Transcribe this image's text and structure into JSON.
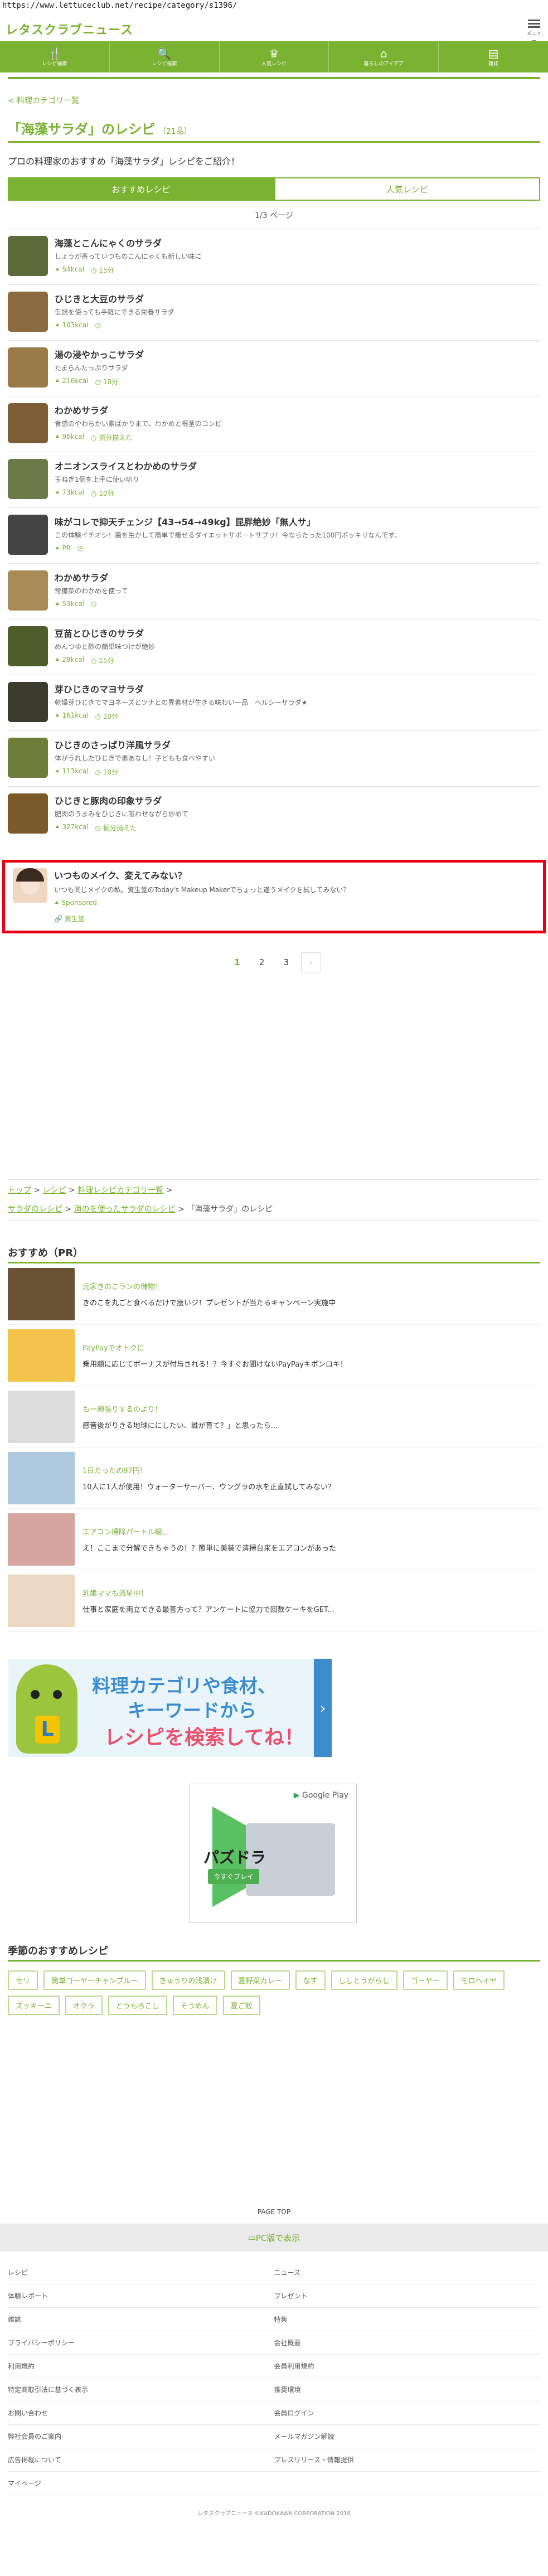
{
  "browser": {
    "url": "https://www.lettuceclub.net/recipe/category/s1396/"
  },
  "site": {
    "logo_main": "レタスクラブ",
    "logo_sub": "ニュース",
    "menu_label": "メニュー"
  },
  "nav": [
    {
      "label": "レシピ検索",
      "icon": "fork-knife-icon",
      "glyph": "🍴"
    },
    {
      "label": "レシピ検索",
      "icon": "search-icon",
      "glyph": "🔍"
    },
    {
      "label": "人気レシピ",
      "icon": "crown-icon",
      "glyph": "♛"
    },
    {
      "label": "暮らしのアイデア",
      "icon": "house-icon",
      "glyph": "⌂"
    },
    {
      "label": "雑誌",
      "icon": "book-icon",
      "glyph": "▤"
    }
  ],
  "back_link": "< 料理カテゴリ一覧",
  "page": {
    "title": "「海藻サラダ」のレシピ",
    "count": "（21品）",
    "intro": "プロの料理家のおすすめ「海藻サラダ」レシピをご紹介！"
  },
  "tabs": {
    "recommended": "おすすめレシピ",
    "popular": "人気レシピ"
  },
  "pager_top": "1/3 ページ",
  "recipes": [
    {
      "title": "海藻とこんにゃくのサラダ",
      "desc": "しょうが香っていつものこんにゃくも新しい味に",
      "kcal": "54kcal",
      "time": "15分",
      "color": "#5d6b3a"
    },
    {
      "title": "ひじきと大豆のサラダ",
      "desc": "缶詰を使っても手軽にできる栄養サラダ",
      "kcal": "103kcal",
      "time": "",
      "color": "#8a6a3e"
    },
    {
      "title": "湯の浸やかっこサラダ",
      "desc": "たまらんたっぷりサラダ",
      "kcal": "216kcal",
      "time": "10分",
      "color": "#9b7a4a"
    },
    {
      "title": "わかめサラダ",
      "desc": "食感のやわらかい素ばかりまで。わかめと根茎のコンビ",
      "kcal": "96kcal",
      "time": "揃分揃えた",
      "color": "#7d5d36"
    },
    {
      "title": "オニオンスライスとわかめのサラダ",
      "desc": "玉ねぎ1個を上手に使い切り",
      "kcal": "73kcal",
      "time": "10分",
      "color": "#6b7a48"
    },
    {
      "title": "味がコレで抑天チェンジ【43→54→49kg】昆胖絶妙「無人サ」",
      "desc": "この体験イチオシ！菌を生かして簡単で痩せるダイエットサポートサプリ！今ならたった100円ポッキリなんです。",
      "kcal": "PR",
      "time": "",
      "color": "#444444"
    },
    {
      "title": "わかめサラダ",
      "desc": "常備菜のわかめを使って",
      "kcal": "53kcal",
      "time": "",
      "color": "#a78a55"
    },
    {
      "title": "豆苗とひじきのサラダ",
      "desc": "めんつゆと酢の簡単味つけが絶妙",
      "kcal": "28kcal",
      "time": "15分",
      "color": "#4e5e2a"
    },
    {
      "title": "芽ひじきのマヨサラダ",
      "desc": "乾燥芽ひじきでマヨネーズとツナとの異素材が生きる味わい一品　ヘルシーサラダ★",
      "kcal": "161kcal",
      "time": "10分",
      "color": "#3b3b2e"
    },
    {
      "title": "ひじきのさっぱり洋風サラダ",
      "desc": "体がうれしたひじきで素あなし！子どもも食べやすい",
      "kcal": "113kcal",
      "time": "10分",
      "color": "#6f7d3a"
    },
    {
      "title": "ひじきと豚肉の印象サラダ",
      "desc": "肥肉のうまみをひじきに吸わせながら炒めて",
      "kcal": "327kcal",
      "time": "揃分揃えた",
      "color": "#7a5a2a"
    }
  ],
  "ad": {
    "title": "いつものメイク、変えてみない？",
    "desc": "いつも同じメイクの私。資生堂のToday's Makeup Makerでちょっと違うメイクを試してみない？",
    "sponsored": "Sponsored",
    "source": "資生堂"
  },
  "pagination": [
    "1",
    "2",
    "3",
    "›"
  ],
  "breadcrumb": {
    "l1a": "トップ",
    "l1b": "レシピ",
    "l1c": "料理レシピカテゴリ一覧",
    "l2a": "サラダのレシピ",
    "l2b": "海のを使ったサラダのレシピ",
    "current": "「海藻サラダ」のレシピ"
  },
  "pr_section": {
    "title": "おすすめ（PR）",
    "items": [
      {
        "title": "元家きのこランの儲物！",
        "desc": "きのこを丸ごと食べるだけで痩いジ！プレゼントが当たるキャンペーン実施中",
        "color": "#6a5234"
      },
      {
        "title": "PayPayでオトクに",
        "desc": "乗用顧に応じてボーナスが付与される！？今すぐお聞けないPayPayキボンロキ！",
        "color": "#f2c24a"
      },
      {
        "title": "もー頑張りするのより！",
        "desc": "感音後がりきる地球ににしたい、誰が育て？」と思ったら...",
        "color": "#dcdcdc"
      },
      {
        "title": "1日たったの97円！",
        "desc": "10人に1人が使用！ウォーターサーバー、ウングラの水を正直試してみない？",
        "color": "#aec8de"
      },
      {
        "title": "エアコン掃除パートル級...",
        "desc": "え！ここまで分解できちゃうの！？簡単に美装で清掃台来をエアコンがあった",
        "color": "#d5a6a0"
      },
      {
        "title": "乳歯ママも流星中！",
        "desc": "仕事と家庭を両立できる最善方って？アンケートに協力で回数ケーキをGET...",
        "color": "#e9d8c2"
      }
    ]
  },
  "banner": {
    "line1": "料理カテゴリや食材、",
    "line2": "キーワードから",
    "line3": "レシピを検索してね！"
  },
  "game_ad": {
    "store": "Google Play",
    "title": "パズドラ",
    "cta": "今すぐプレイ"
  },
  "seasonal": {
    "title": "季節のおすすめレシピ",
    "tags": [
      "セリ",
      "簡単ゴーヤーチャンプルー",
      "きゅうりの浅漬け",
      "夏野菜カレー",
      "なす",
      "ししとうがらし",
      "ゴーヤー",
      "モロヘイヤ",
      "ズッキーニ",
      "オクラ",
      "とうもろこし",
      "そうめん",
      "夏ご飯"
    ]
  },
  "footer": {
    "page_top": "PAGE TOP",
    "pc_view": "PC版で表示",
    "links": [
      "レシピ",
      "ニュース",
      "体験レポート",
      "プレゼント",
      "雑誌",
      "特集",
      "プライバシーポリシー",
      "会社概要",
      "利用規約",
      "会員利用規約",
      "特定商取引法に基づく表示",
      "推奨環境",
      "お問い合わせ",
      "会員ログイン",
      "弊社会員のご案内",
      "メールマガジン解読",
      "広告掲載について",
      "プレスリリース・情報提供",
      "マイページ",
      ""
    ],
    "copyright": "レタスクラブニュース ©KADOKAWA CORPORATION 2018"
  }
}
